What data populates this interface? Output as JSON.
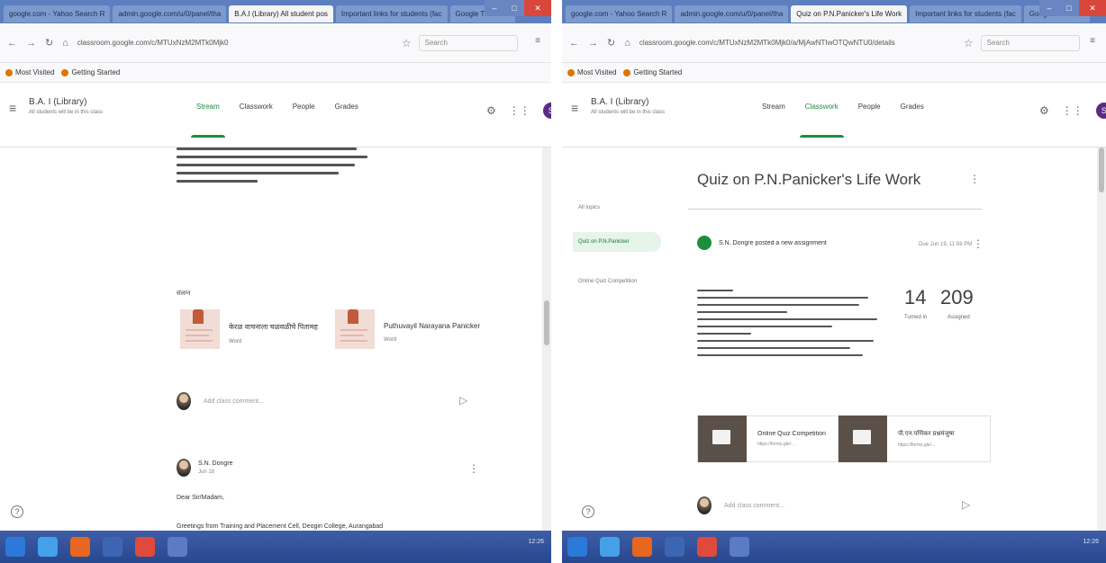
{
  "left": {
    "browser": {
      "tabs": [
        "google.com - Yahoo Search R",
        "admin.google.com/u/0/panel/tha",
        "B.A.I (Library) All student pos",
        "Important links for students (fac",
        "Google Translate"
      ],
      "active_tab": 2,
      "url": "classroom.google.com/c/MTUxNzM2MTk0Mjk0",
      "search_placeholder": "Search",
      "bookmarks": [
        "Most Visited",
        "Getting Started"
      ]
    },
    "classroom": {
      "class_name": "B.A. I (Library)",
      "class_subtitle": "All students will be in this class",
      "nav": [
        "Stream",
        "Classwork",
        "People",
        "Grades"
      ],
      "active_nav": 0
    },
    "files_heading": "संलग्न",
    "attachments": [
      {
        "title": "केरळ वाचनाला चळवळीचे पितामह",
        "type": "Word"
      },
      {
        "title": "Puthuvayil Narayana Panicker",
        "type": "Word"
      }
    ],
    "comment_placeholder": "Add class comment...",
    "post": {
      "author": "S.N. Dongre",
      "date": "Jun 18",
      "greeting": "Dear Sir/Madam,",
      "footer_text": "Greetings from Training and Placement Cell, Deogiri College, Aurangabad"
    },
    "taskbar_time": "12:26"
  },
  "right": {
    "browser": {
      "tabs": [
        "google.com - Yahoo Search R",
        "admin.google.com/u/0/panel/tha",
        "Quiz on P.N.Panicker's Life Work",
        "Important links for students (fac",
        "Google Translate"
      ],
      "active_tab": 2,
      "url": "classroom.google.com/c/MTUxNzM2MTk0Mjk0/a/MjAwNTIwOTQwNTU0/details",
      "search_placeholder": "Search",
      "bookmarks": [
        "Most Visited",
        "Getting Started"
      ]
    },
    "classroom": {
      "class_name": "B.A. I (Library)",
      "class_subtitle": "All students will be in this class",
      "nav": [
        "Stream",
        "Classwork",
        "People",
        "Grades"
      ],
      "active_nav": 1
    },
    "side_items": [
      "All topics",
      "Quiz on P.N.Panicker",
      "Online Quiz Competition"
    ],
    "quiz_title": "Quiz on P.N.Panicker's Life Work",
    "post_meta": "S.N. Dongre posted a new assignment",
    "due": "Due Jun 19, 11:59 PM",
    "stats": [
      {
        "value": "14",
        "label": "Turned in"
      },
      {
        "value": "209",
        "label": "Assigned"
      }
    ],
    "attachments": [
      {
        "title": "Online Quiz Competition",
        "url": "https://forms.gle/..."
      },
      {
        "title": "पी.एन.पणिकर प्रश्नमंजुषा",
        "url": "https://forms.gle/..."
      }
    ],
    "comment_placeholder": "Add class comment...",
    "taskbar_time": "12:26"
  },
  "colors": {
    "accent": "#1e8e3e",
    "taskbar": "#2d4d96",
    "tabbar": "#5d7fbf"
  }
}
